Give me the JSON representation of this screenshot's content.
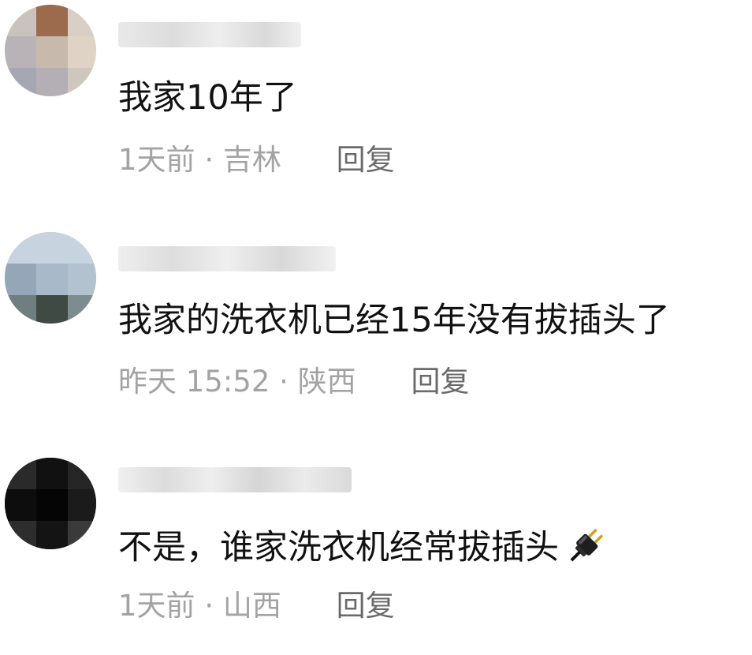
{
  "comments": [
    {
      "content": "我家10年了",
      "time": "1天前",
      "separator": "·",
      "location": "吉林",
      "reply_label": "回复"
    },
    {
      "content": "我家的洗衣机已经15年没有拔插头了",
      "time": "昨天 15:52",
      "separator": "·",
      "location": "陕西",
      "reply_label": "回复"
    },
    {
      "content": "不是，谁家洗衣机经常拔插头",
      "time": "1天前",
      "separator": "·",
      "location": "山西",
      "reply_label": "回复",
      "emoji_icon": "electric-plug-icon"
    }
  ],
  "colors": {
    "text_primary": "#111111",
    "text_meta": "#a3a3a3",
    "reply": "#6a6a6a",
    "background": "#ffffff"
  }
}
